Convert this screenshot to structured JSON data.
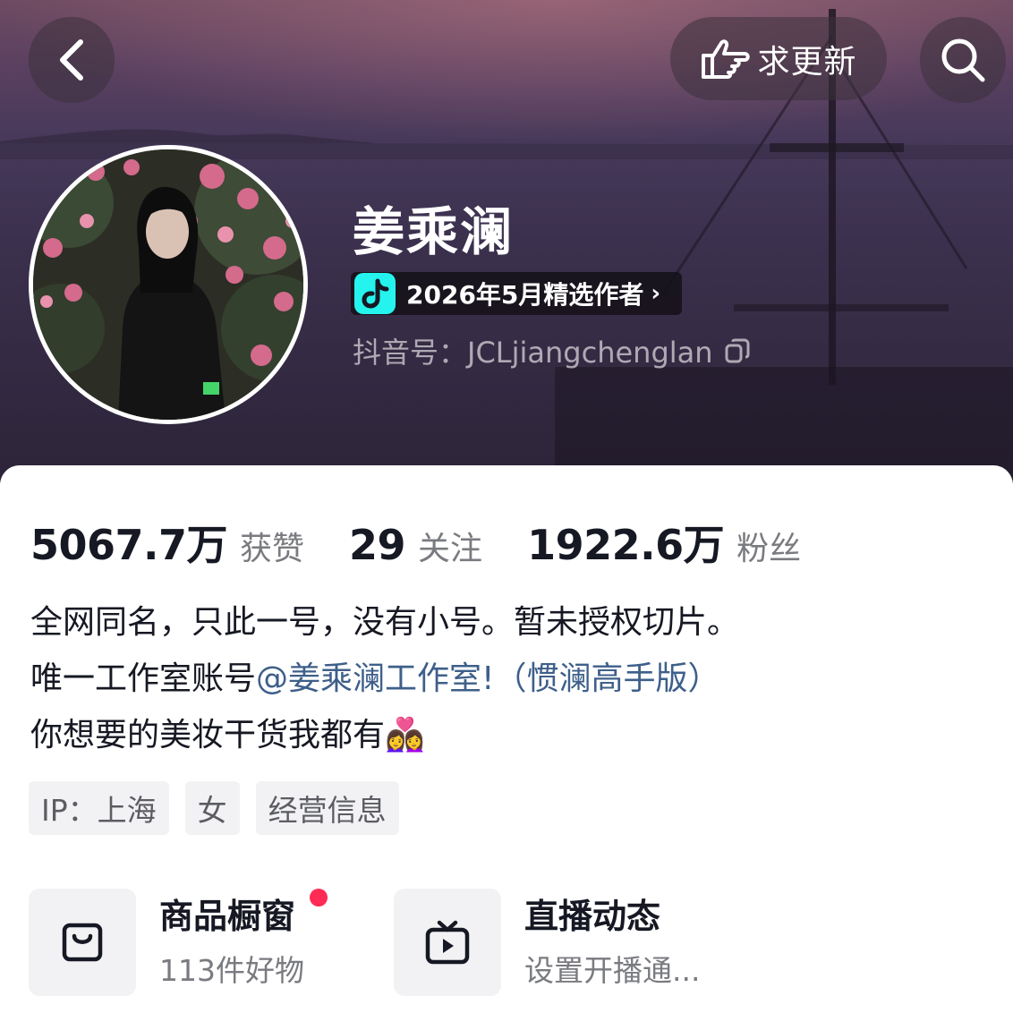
{
  "header": {
    "update_label": "求更新",
    "back_icon": "chevron-left-icon",
    "search_icon": "search-icon",
    "update_icon": "pointing-hand-icon"
  },
  "profile": {
    "name": "姜乘澜",
    "creator_badge": "2026年5月精选作者",
    "douyin_id_label": "抖音号：",
    "douyin_id": "JCLjiangchenglan"
  },
  "stats": [
    {
      "value": "5067.7万",
      "label": "获赞"
    },
    {
      "value": "29",
      "label": "关注"
    },
    {
      "value": "1922.6万",
      "label": "粉丝"
    }
  ],
  "bio": {
    "line1": "全网同名，只此一号，没有小号。暂未授权切片。",
    "line2_prefix": "唯一工作室账号",
    "line2_mention": "@姜乘澜工作室!（惯澜高手版）",
    "line3_text": "你想要的美妆干货我都有",
    "line3_emoji": "👩‍❤️‍👩"
  },
  "tags": [
    "IP：上海",
    "女",
    "经营信息"
  ],
  "features": {
    "shop": {
      "title": "商品橱窗",
      "subtitle": "113件好物"
    },
    "live": {
      "title": "直播动态",
      "subtitle": "设置开播通..."
    }
  },
  "colors": {
    "accent_red": "#fe2c55",
    "mention_blue": "#3e5f8a",
    "tiktok_cyan": "#25f4ee"
  }
}
